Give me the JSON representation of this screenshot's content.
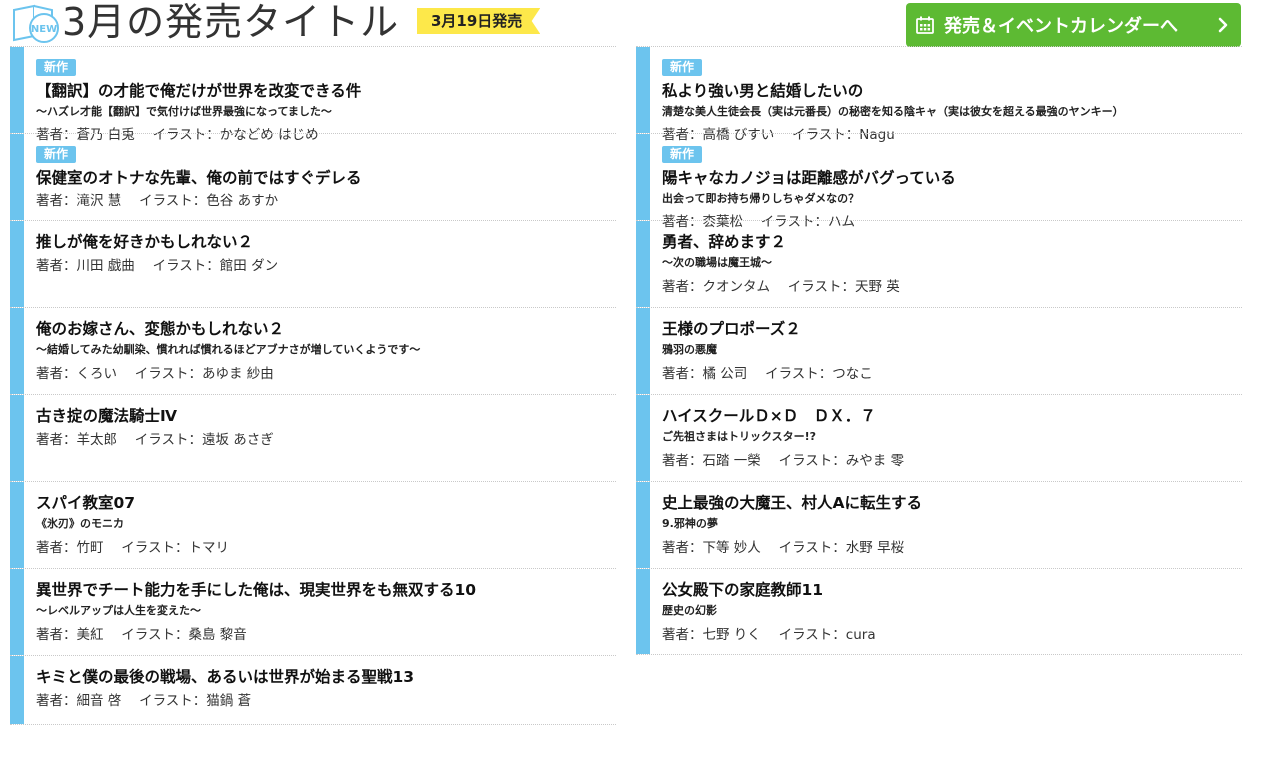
{
  "header": {
    "icon_name": "new-book-icon",
    "icon_text": "NEW",
    "title": "3月の発売タイトル",
    "date_badge": "3月19日発売",
    "calendar_button": "発売＆イベントカレンダーへ",
    "calendar_icon": "calendar-icon",
    "chevron_icon": "chevron-right-icon"
  },
  "colors": {
    "accent_blue": "#6cc4ee",
    "badge_yellow": "#fde84a",
    "button_green": "#5dba33"
  },
  "left_column": [
    {
      "badge": "新作",
      "title": "【翻訳】の才能で俺だけが世界を改変できる件",
      "subtitle": "〜ハズレ才能【翻訳】で気付けば世界最強になってました〜",
      "credits": "著者：蒼乃 白兎　 イラスト：かなどめ はじめ"
    },
    {
      "badge": "新作",
      "title": "保健室のオトナな先輩、俺の前ではすぐデレる",
      "subtitle": "",
      "credits": "著者：滝沢 慧　 イラスト：色谷 あすか"
    },
    {
      "badge": "",
      "title": "推しが俺を好きかもしれない２",
      "subtitle": "",
      "credits": "著者：川田 戯曲　 イラスト：館田 ダン"
    },
    {
      "badge": "",
      "title": "俺のお嫁さん、変態かもしれない２",
      "subtitle": "〜結婚してみた幼馴染、慣れれば慣れるほどアブナさが増していくようです〜",
      "credits": "著者：くろい　 イラスト：あゆま 紗由"
    },
    {
      "badge": "",
      "title": "古き掟の魔法騎士Ⅳ",
      "subtitle": "",
      "credits": "著者：羊太郎　 イラスト：遠坂 あさぎ"
    },
    {
      "badge": "",
      "title": "スパイ教室07",
      "subtitle": "《氷刃》のモニカ",
      "credits": "著者：竹町　 イラスト：トマリ"
    },
    {
      "badge": "",
      "title": "異世界でチート能力を手にした俺は、現実世界をも無双する10",
      "subtitle": "〜レベルアップは人生を変えた〜",
      "credits": "著者：美紅　 イラスト：桑島 黎音"
    },
    {
      "badge": "",
      "title": "キミと僕の最後の戦場、あるいは世界が始まる聖戦13",
      "subtitle": "",
      "credits": "著者：細音 啓　 イラスト：猫鍋 蒼"
    }
  ],
  "right_column": [
    {
      "badge": "新作",
      "title": "私より強い男と結婚したいの",
      "subtitle": "清楚な美人生徒会長（実は元番長）の秘密を知る陰キャ（実は彼女を超える最強のヤンキー）",
      "credits": "著者：高橋 びすい　 イラスト：Nagu"
    },
    {
      "badge": "新作",
      "title": "陽キャなカノジョは距離感がバグっている",
      "subtitle": "出会って即お持ち帰りしちゃダメなの？",
      "credits": "著者：枩葉松　 イラスト：ハム"
    },
    {
      "badge": "",
      "title": "勇者、辞めます２",
      "subtitle": "〜次の職場は魔王城〜",
      "credits": "著者：クオンタム　 イラスト：天野 英"
    },
    {
      "badge": "",
      "title": "王様のプロポーズ２",
      "subtitle": "鴉羽の悪魔",
      "credits": "著者：橘 公司　 イラスト：つなこ"
    },
    {
      "badge": "",
      "title": "ハイスクールＤ×Ｄ　ＤＸ．７",
      "subtitle": "ご先祖さまはトリックスター!?",
      "credits": "著者：石踏 一榮　 イラスト：みやま 零"
    },
    {
      "badge": "",
      "title": "史上最強の大魔王、村人Aに転生する",
      "subtitle": "9.邪神の夢",
      "credits": "著者：下等 妙人　 イラスト：水野 早桜"
    },
    {
      "badge": "",
      "title": "公女殿下の家庭教師11",
      "subtitle": "歴史の幻影",
      "credits": "著者：七野 りく　 イラスト：cura"
    }
  ]
}
